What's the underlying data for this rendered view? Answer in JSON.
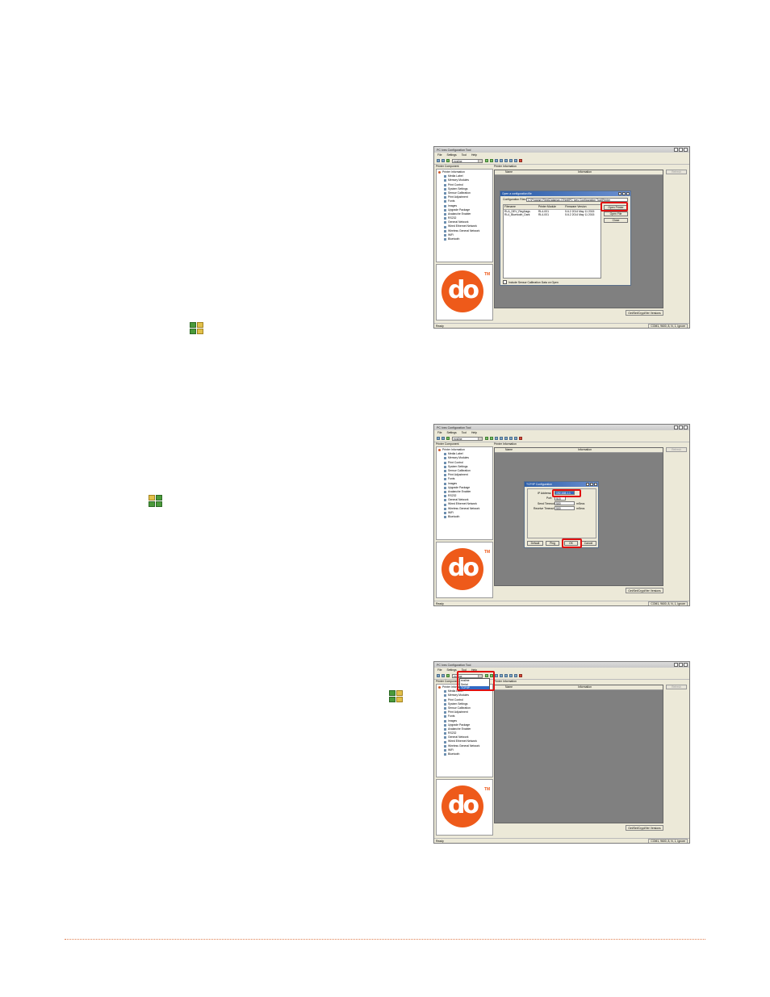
{
  "app": {
    "title": "PC Ives Configuration Tool",
    "menu": [
      "File",
      "Settings",
      "Tool",
      "Help"
    ],
    "combo_value": "ecsline",
    "left_header": "Printer Component",
    "right_header": "Printer Information",
    "col_name": "Name",
    "col_info": "Information",
    "refresh_label": "Refresh",
    "fw_button": "Get/Set/Crypt/Ver Versions",
    "status_left": "Ready",
    "status_right": "COM1, 9600, 8, N, 1, Ignore",
    "logo_text": "do",
    "logo_tm": "TM",
    "tree": [
      {
        "label": "Printer Information",
        "root": true
      },
      {
        "label": "Media Label"
      },
      {
        "label": "Memory Modules"
      },
      {
        "label": "Print Control"
      },
      {
        "label": "System Settings"
      },
      {
        "label": "Sensor Calibration"
      },
      {
        "label": "Print Adjustment"
      },
      {
        "label": "Fonts"
      },
      {
        "label": "Images"
      },
      {
        "label": "Upgrade Package"
      },
      {
        "label": "Avalanche Enabler"
      },
      {
        "label": "RS232"
      },
      {
        "label": "General Network"
      },
      {
        "label": "Wired Ethernet Network"
      },
      {
        "label": "Wireless General Network"
      },
      {
        "label": "WiFi"
      },
      {
        "label": "Bluetooth"
      }
    ]
  },
  "dialog1": {
    "title": "Open a configuration file",
    "path_label": "Configuration Files In:",
    "path_value": "C:\\Program Files\\Datamax-O'Neil\\PC Ives Configuration Tool\\Printer",
    "headers": [
      "Filename",
      "Printer Module",
      "Firmware Version"
    ],
    "rows": [
      [
        "RLA_DEV_Reg1tags",
        "RL4-001",
        "5.6.2 2014 May 11 2015"
      ],
      [
        "RL4_Bluetooth_Dark",
        "RL4-001",
        "5.6.2 2014 May 11 2015"
      ]
    ],
    "btn_open": "Open Printer",
    "btn_file": "Open File",
    "btn_close": "Close",
    "checkbox_label": "Include Sensor Calibration Data on Open"
  },
  "dialog2": {
    "title": "TCP/IP Configuration",
    "ip_label": "IP Address:",
    "ip_value": "192.168.1.1",
    "port_label": "Port:",
    "port_value": "515",
    "send_label": "Send Timeout:",
    "send_value": "500",
    "recv_label": "Receive Timeout:",
    "recv_value": "500",
    "unit": "mSecs",
    "btn_default": "Default",
    "btn_ping": "Ping",
    "btn_ok": "OK",
    "btn_cancel": "Cancel"
  },
  "dropdown3": {
    "options": [
      "ecsline",
      "Serial",
      "TCP/IP"
    ],
    "selected_index": 2
  }
}
